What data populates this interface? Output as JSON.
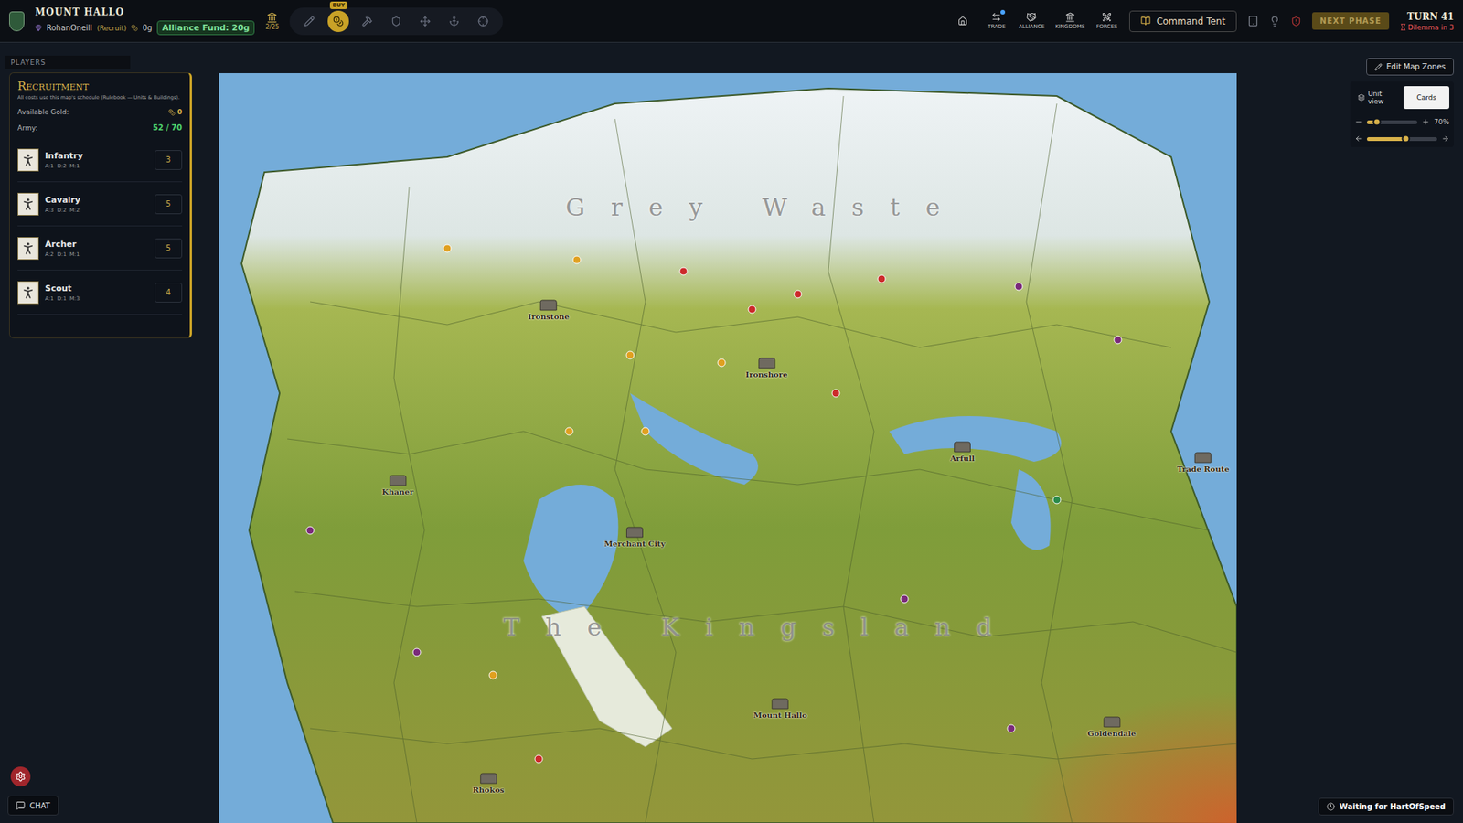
{
  "header": {
    "title": "MOUNT HALLO",
    "player": "RohanOneill",
    "rank": "(Recruit)",
    "gold": "0g",
    "alliance_fund": "Alliance Fund: 20g",
    "treasury": "2/25"
  },
  "tools": [
    {
      "selected": false,
      "badge": ""
    },
    {
      "selected": true,
      "badge": "BUY"
    },
    {
      "selected": false,
      "badge": ""
    },
    {
      "selected": false,
      "badge": ""
    },
    {
      "selected": false,
      "badge": ""
    },
    {
      "selected": false,
      "badge": ""
    },
    {
      "selected": false,
      "badge": ""
    }
  ],
  "nav": [
    {
      "label": "",
      "badge": false
    },
    {
      "label": "TRADE",
      "badge": true
    },
    {
      "label": "ALLIANCE",
      "badge": false
    },
    {
      "label": "KINGDOMS",
      "badge": false
    },
    {
      "label": "FORCES",
      "badge": false
    }
  ],
  "command_tent": "Command Tent",
  "next_phase": {
    "label": "NEXT PHASE",
    "disabled": true
  },
  "turn": "TURN 41",
  "dilemma": "Dilemma in 3",
  "players_tab": "PLAYERS",
  "edit_zones": "Edit Map Zones",
  "recruitment": {
    "title": "Recruitment",
    "subtitle": "All costs use this map's schedule (Rulebook — Units & Buildings).",
    "gold_label": "Available Gold:",
    "gold": "0",
    "army_label": "Army:",
    "army": "52 / 70",
    "units": [
      {
        "name": "Infantry",
        "stats": "A:1  D:2  M:1",
        "cost": "3"
      },
      {
        "name": "Cavalry",
        "stats": "A:3  D:2  M:2",
        "cost": "5"
      },
      {
        "name": "Archer",
        "stats": "A:2  D:1  M:1",
        "cost": "5"
      },
      {
        "name": "Scout",
        "stats": "A:1  D:1  M:3",
        "cost": "4"
      }
    ]
  },
  "view_toggle": [
    {
      "label": "Unit view",
      "selected": false
    },
    {
      "label": "Cards",
      "selected": true
    }
  ],
  "zoom": {
    "reading": "70%",
    "level": 0.2
  },
  "pan": {
    "level": 0.55
  },
  "map": {
    "regions": [
      "Grey Waste",
      "The Kingsland"
    ],
    "labels": [
      "Ironstone",
      "Ironshore",
      "Arfull",
      "Khaner",
      "Merchant City",
      "Mount Hallo",
      "Goldendale",
      "Rhokos",
      "Trade Route"
    ]
  },
  "chat": "CHAT",
  "status": "Waiting for HartOfSpeed"
}
